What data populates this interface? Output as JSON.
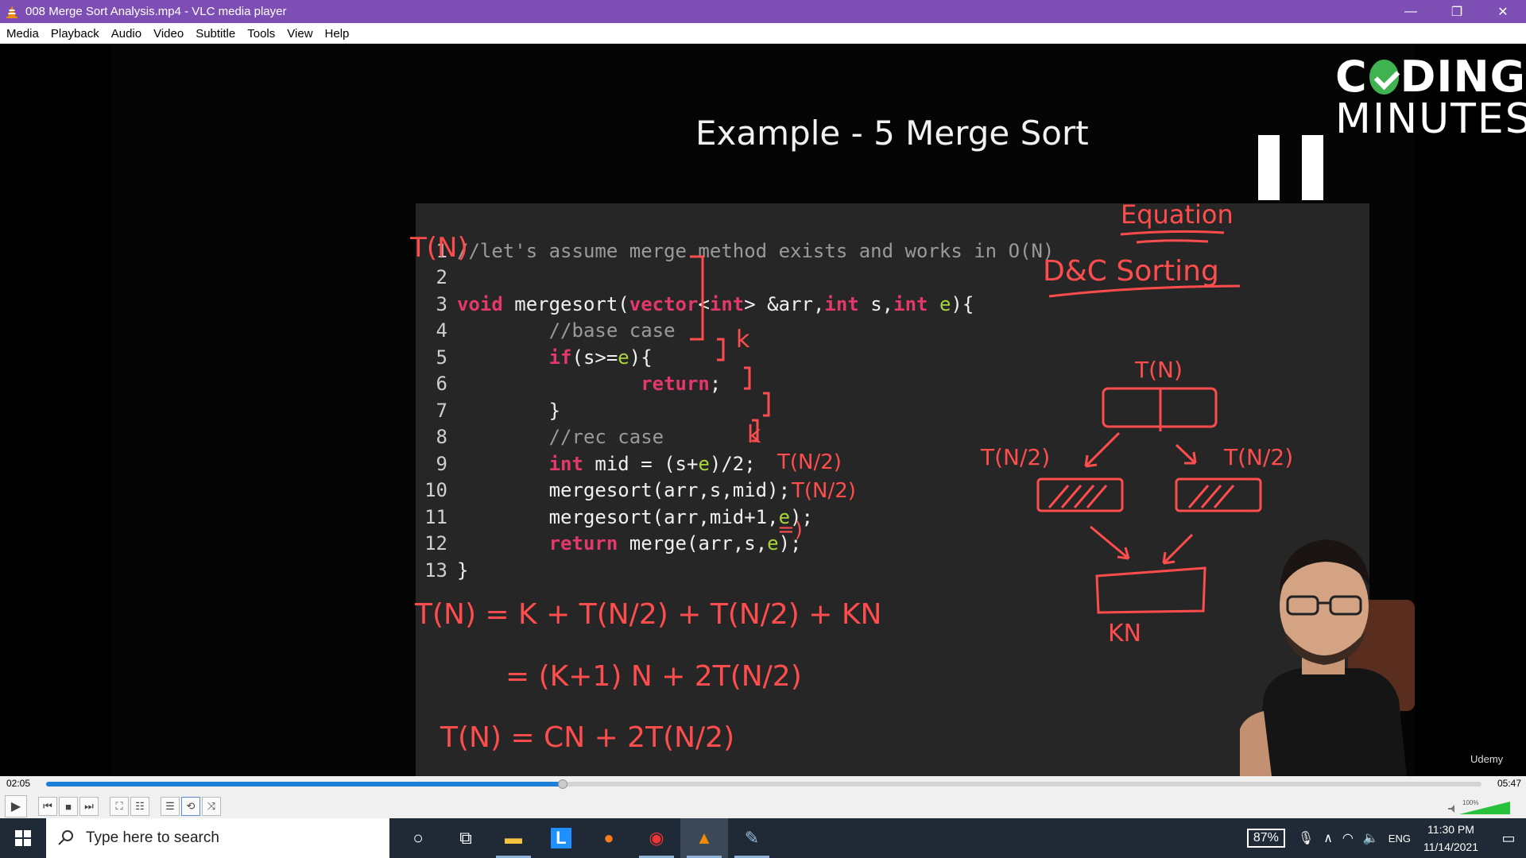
{
  "window": {
    "title": "008 Merge Sort Analysis.mp4 - VLC media player",
    "minimize": "—",
    "restore": "❐",
    "close": "✕"
  },
  "menu": [
    "Media",
    "Playback",
    "Audio",
    "Video",
    "Subtitle",
    "Tools",
    "View",
    "Help"
  ],
  "video": {
    "slide_title": "Example - 5 Merge Sort",
    "logo_line1_a": "C",
    "logo_line1_b": "DING",
    "logo_line2": "MINUTES",
    "watermark": "Udemy",
    "code_lines": [
      {
        "n": "1"
      },
      {
        "n": "2"
      },
      {
        "n": "3"
      },
      {
        "n": "4"
      },
      {
        "n": "5"
      },
      {
        "n": "6"
      },
      {
        "n": "7"
      },
      {
        "n": "8"
      },
      {
        "n": "9"
      },
      {
        "n": "10"
      },
      {
        "n": "11"
      },
      {
        "n": "12"
      },
      {
        "n": "13"
      }
    ],
    "code": {
      "l1": "//let's assume merge method exists and works in O(N)",
      "l3_void": "void",
      "l3_name": " mergesort(",
      "l3_vector": "vector",
      "l3_lt": "<",
      "l3_int": "int",
      "l3_rest1": "> &arr,",
      "l3_int2": "int",
      "l3_s": " s,",
      "l3_int3": "int",
      "l3_e": " e",
      "l3_end": "){",
      "l4": "//base case",
      "l5_if": "if",
      "l5_a": "(s>=",
      "l5_e": "e",
      "l5_b": "){",
      "l6_ret": "return",
      "l6_semi": ";",
      "l7": "}",
      "l8": "//rec case",
      "l9_int": "int",
      "l9_a": " mid = (s+",
      "l9_e": "e",
      "l9_b": ")/2;",
      "l10": "mergesort(arr,s,mid);",
      "l11_a": "mergesort(arr,mid+1,",
      "l11_e": "e",
      "l11_b": ");",
      "l12_ret": "return",
      "l12_a": " merge(arr,s,",
      "l12_e": "e",
      "l12_b": ");",
      "l13": "}"
    },
    "annotations": {
      "tn_top": "T(N)",
      "k1": "k",
      "k2": "k",
      "tn2_a": "T(N/2)",
      "tn2_b": "T(N/2)",
      "arrow_eq": "=)",
      "equation": "Equation",
      "dc_sorting": "D&C  Sorting",
      "tree_root": "T(N)",
      "tree_left": "T(N/2)",
      "tree_right": "T(N/2)",
      "tree_merge": "KN",
      "eq1": "T(N) =   K +  T(N/2)  + T(N/2) + KN",
      "eq2": "= (K+1) N   +  2T(N/2)",
      "eq3": "T(N) =   CN  +  2T(N/2)"
    }
  },
  "player": {
    "elapsed": "02:05",
    "total": "05:47",
    "progress": 0.36,
    "volume_label": "100%",
    "volume": 1.0,
    "buttons": [
      "play",
      "prev",
      "stop",
      "next",
      "fullscreen",
      "extended-settings",
      "playlist",
      "loop",
      "shuffle"
    ]
  },
  "taskbar": {
    "search_placeholder": "Type here to search",
    "battery": "87%",
    "language": "ENG",
    "time": "11:30 PM",
    "date": "11/14/2021"
  },
  "colors": {
    "titlebar": "#7d4fb4",
    "ink": "#ff4d4d",
    "keyword": "#e3386a",
    "seek_fill": "#1e7fd8",
    "taskbar": "#1f2a36"
  }
}
